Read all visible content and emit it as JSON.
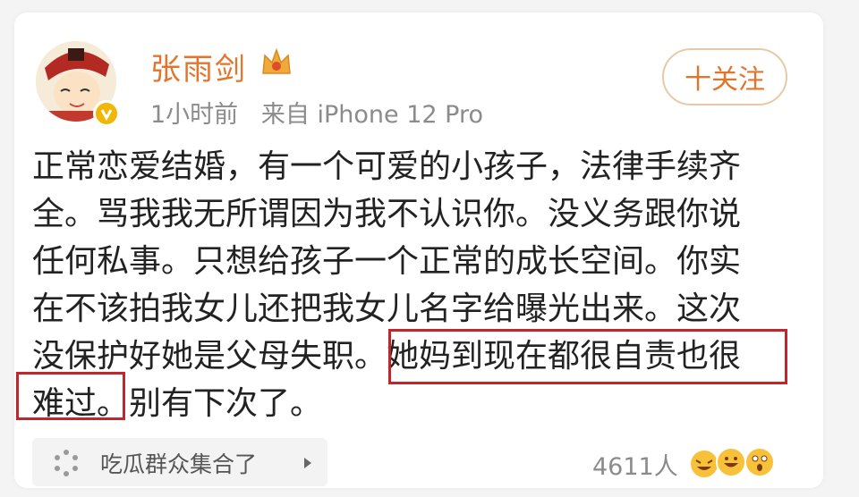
{
  "post": {
    "author": "张雨剑",
    "meta": "1小时前   来自 iPhone 12 Pro",
    "follow_label": "十关注",
    "text_lines": [
      "正常恋爱结婚，有一个可爱的小孩子，法律手续齐",
      "全。骂我我无所谓因为我不认识你。没义务跟你说",
      "任何私事。只想给孩子一个正常的成长空间。你实",
      "在不该拍我女儿还把我女儿名字给曝光出来。这次",
      "没保护好她是父母失职。她妈到现在都很自责也很",
      "难过。别有下次了。"
    ],
    "topic": "吃瓜群众集合了",
    "reaction_count": "4611人"
  },
  "icons": {
    "badge": "crown-icon",
    "verified": "verified-badge-icon",
    "topic": "sparkle-icon",
    "arrow": "play-arrow-icon",
    "reactions": [
      "laugh-emoji-icon",
      "grin-emoji-icon",
      "surprised-emoji-icon"
    ]
  },
  "colors": {
    "username": "#e3742b",
    "highlight": "#c0262c",
    "meta": "#8b8b8b"
  }
}
